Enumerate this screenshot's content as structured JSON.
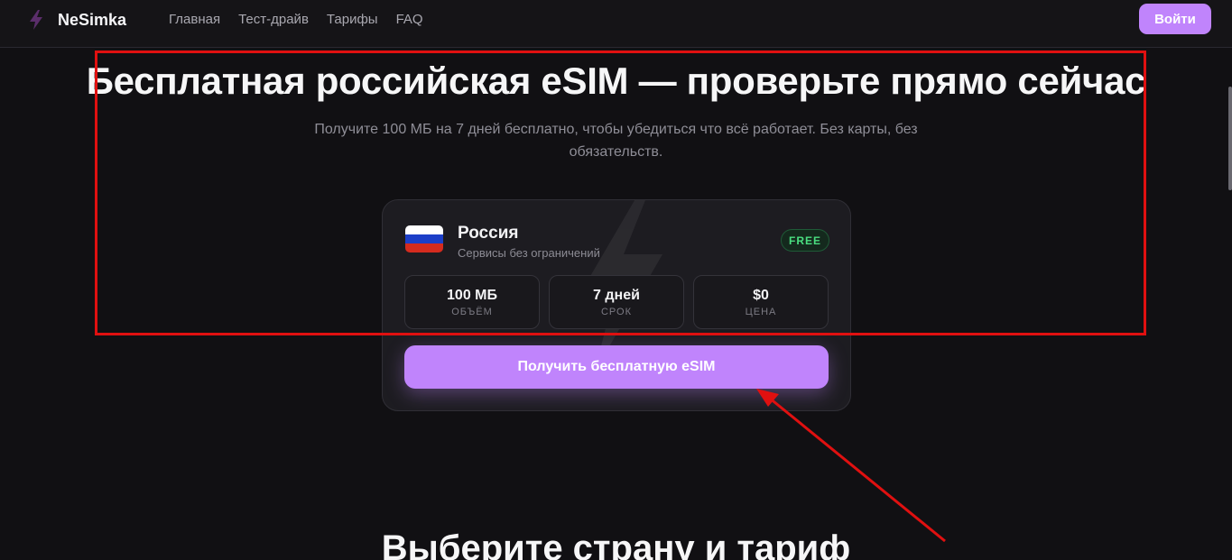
{
  "nav": {
    "brand": "NeSimka",
    "links": [
      "Главная",
      "Тест-драйв",
      "Тарифы",
      "FAQ"
    ],
    "login_label": "Войти"
  },
  "hero": {
    "title": "Бесплатная российская eSIM — проверьте прямо сейчас",
    "subtitle": "Получите 100 МБ на 7 дней бесплатно, чтобы убедиться что всё работает. Без карты, без обязательств."
  },
  "card": {
    "country": "Россия",
    "description": "Сервисы без ограничений",
    "badge": "FREE",
    "stats": [
      {
        "value": "100 МБ",
        "label": "ОБЪЁМ"
      },
      {
        "value": "7 дней",
        "label": "СРОК"
      },
      {
        "value": "$0",
        "label": "ЦЕНА"
      }
    ],
    "cta_label": "Получить бесплатную eSIM"
  },
  "section2": {
    "title": "Выберите страну и тариф"
  },
  "colors": {
    "accent": "#c084fc",
    "background": "#111013",
    "badge_green": "#4ade80",
    "annotation_red": "#e01010"
  },
  "icons": {
    "logo": "lightning-bolt-icon",
    "flag": "russia-flag-icon"
  }
}
